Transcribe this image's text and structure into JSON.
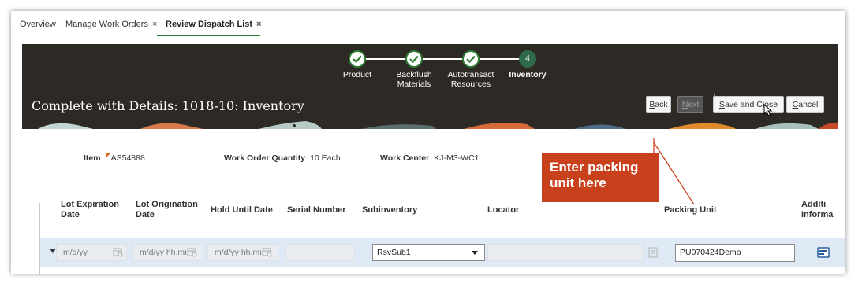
{
  "tabs": [
    {
      "label": "Overview",
      "closable": false
    },
    {
      "label": "Manage Work Orders",
      "closable": true
    },
    {
      "label": "Review Dispatch List",
      "closable": true,
      "active": true
    }
  ],
  "tab_close_glyph": "×",
  "train": {
    "steps": [
      {
        "line1": "Product",
        "line2": "",
        "state": "done"
      },
      {
        "line1": "Backflush",
        "line2": "Materials",
        "state": "done"
      },
      {
        "line1": "Autotransact",
        "line2": "Resources",
        "state": "done"
      },
      {
        "line1": "Inventory",
        "line2": "",
        "state": "current",
        "number": "4"
      }
    ]
  },
  "header": {
    "title": "Complete with Details: 1018-10: Inventory",
    "buttons": {
      "back": {
        "access": "B",
        "rest": "ack"
      },
      "next": {
        "access": "N",
        "rest": "ext"
      },
      "save_close": {
        "access": "S",
        "rest": "ave and Close"
      },
      "cancel": {
        "access": "C",
        "rest": "ancel"
      }
    }
  },
  "details": {
    "item_label": "Item",
    "item_value": "AS54888",
    "qty_label": "Work Order Quantity",
    "qty_value": "10 Each",
    "wc_label": "Work Center",
    "wc_value": "KJ-M3-WC1"
  },
  "callout": {
    "line1": "Enter packing",
    "line2": "unit here"
  },
  "table": {
    "columns": {
      "lot_exp_1": "Lot Expiration",
      "lot_exp_2": "Date",
      "lot_orig_1": "Lot Origination",
      "lot_orig_2": "Date",
      "hold": "Hold Until Date",
      "serial": "Serial Number",
      "subinv": "Subinventory",
      "locator": "Locator",
      "packing": "Packing Unit",
      "addl_1": "Additi",
      "addl_2": "Informa"
    },
    "row": {
      "lot_exp_placeholder": "m/d/yy",
      "lot_orig_placeholder": "m/d/yy hh.mı",
      "hold_placeholder": "m/d/yy hh.mı",
      "subinventory": "RsvSub1",
      "packing_unit": "PU070424Demo"
    }
  },
  "colors": {
    "header_bg": "#2d2a26",
    "accent_green": "#2e7d32",
    "callout": "#c9411c",
    "row_bg": "#dfe9f5"
  }
}
